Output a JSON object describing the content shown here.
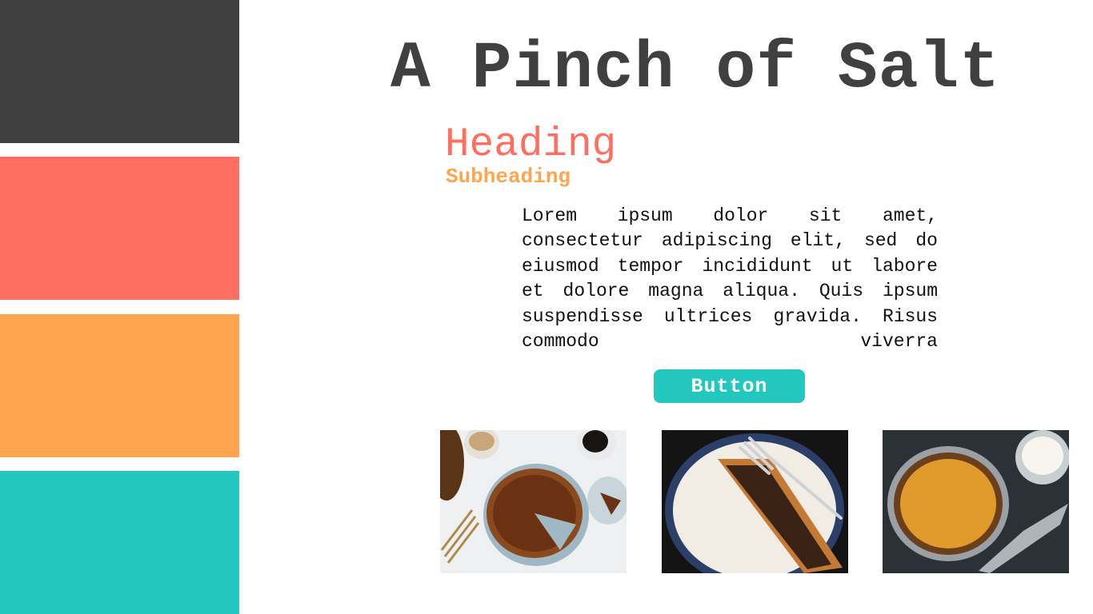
{
  "palette": {
    "dark": "#404040",
    "coral": "#ff6f61",
    "orange": "#ffa54f",
    "teal": "#22c7bd"
  },
  "site_title": "A Pinch of Salt",
  "heading": "Heading",
  "subheading": "Subheading",
  "body_text": "Lorem ipsum dolor sit amet, consectetur adipiscing elit, sed do eiusmod tempor incididunt ut labore et dolore magna aliqua. Quis ipsum suspendisse ultrices gravida. Risus commodo viverra",
  "button_label": "Button",
  "photos": [
    {
      "subject": "pecan-pie-with-coffee-photo"
    },
    {
      "subject": "pie-slice-with-fork-photo"
    },
    {
      "subject": "pumpkin-pie-with-cream-photo"
    }
  ]
}
